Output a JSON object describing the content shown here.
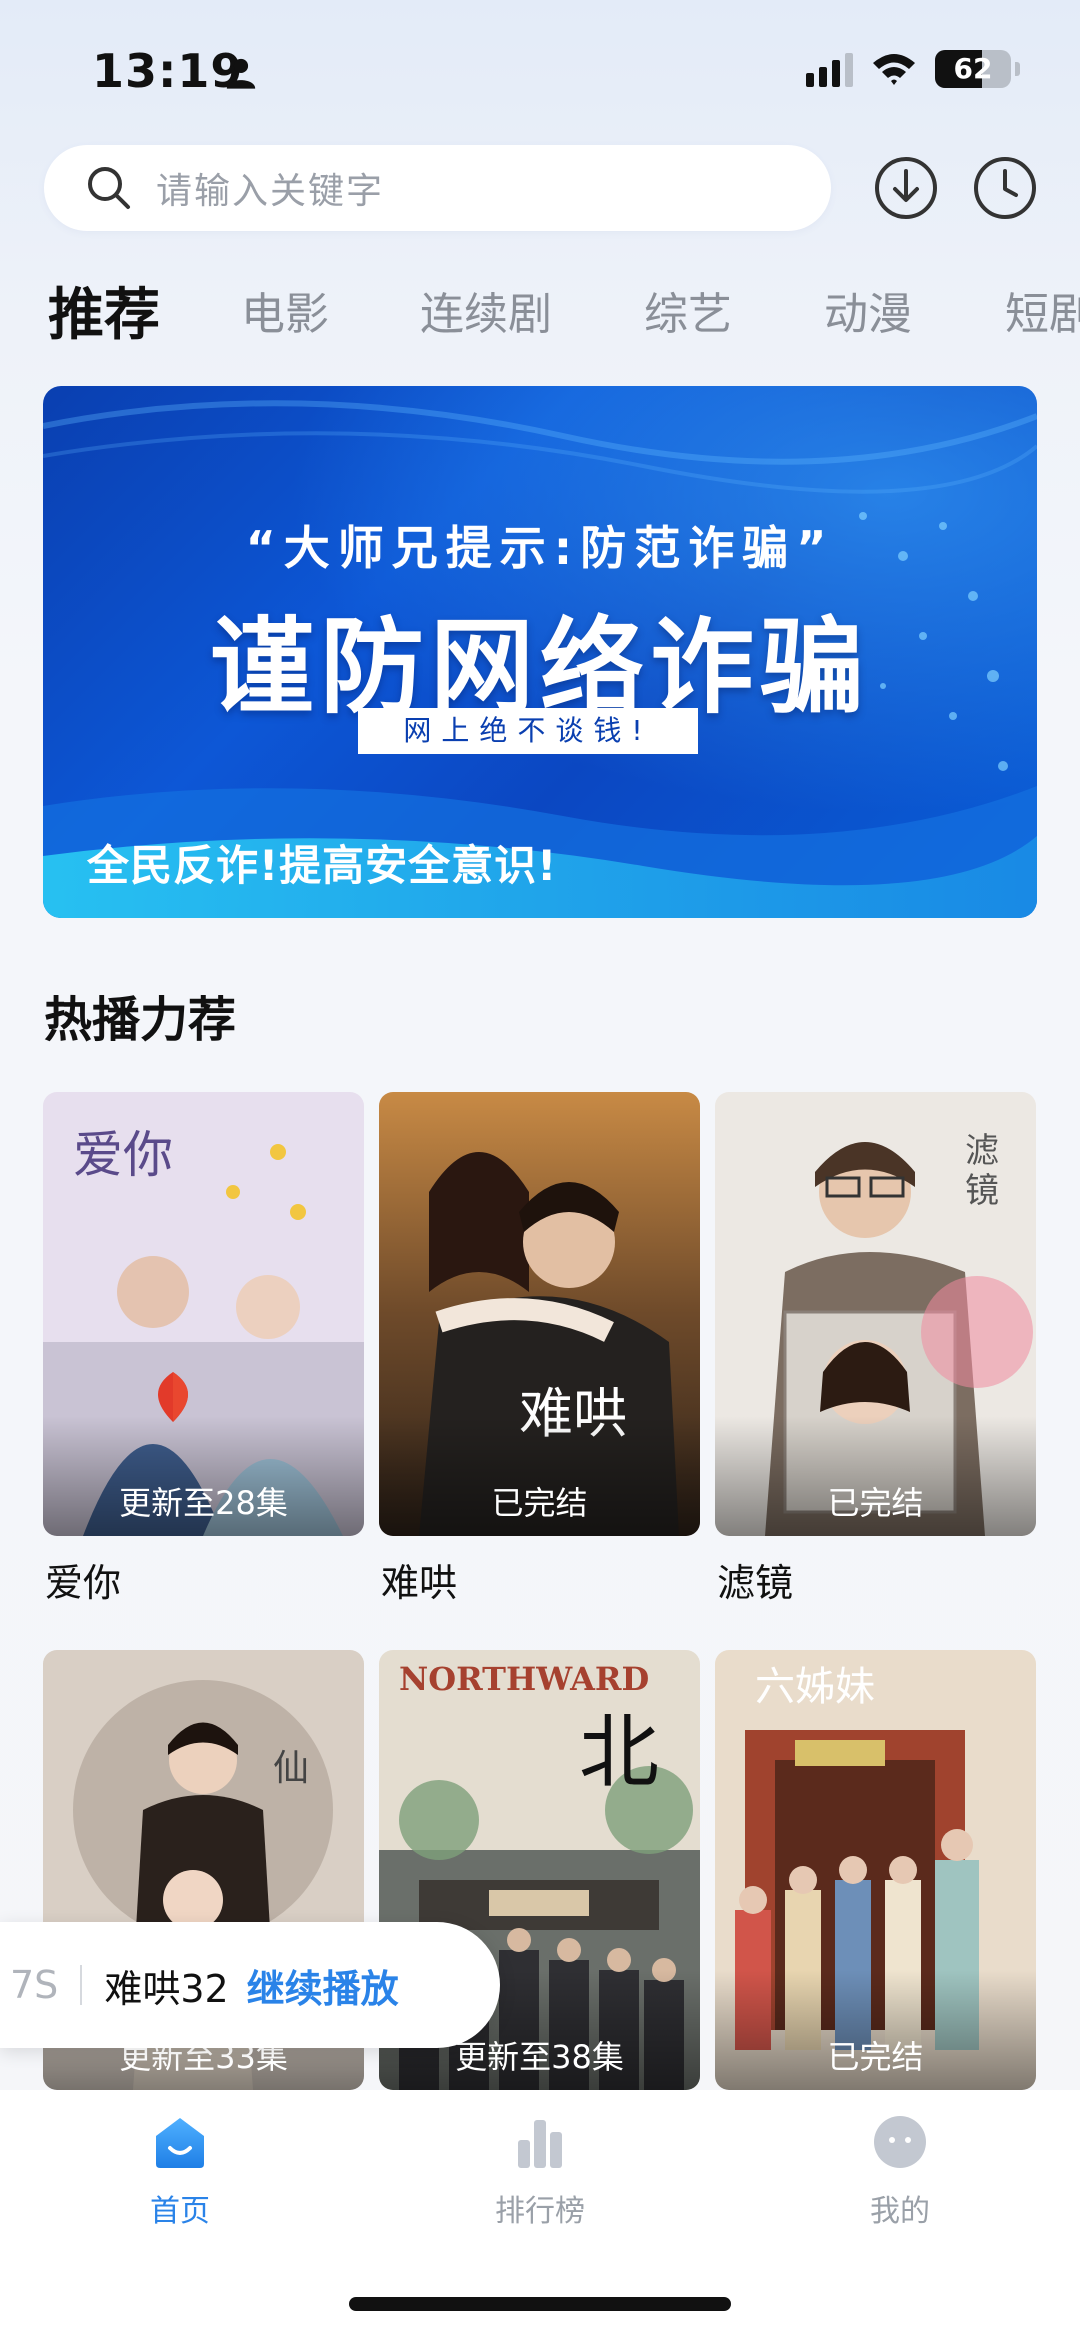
{
  "status_bar": {
    "time": "13:19",
    "battery": "62"
  },
  "search": {
    "placeholder": "请输入关键字"
  },
  "header_icons": [
    "download-icon",
    "history-icon"
  ],
  "tabs": [
    {
      "label": "推荐",
      "active": true
    },
    {
      "label": "电影"
    },
    {
      "label": "连续剧"
    },
    {
      "label": "综艺"
    },
    {
      "label": "动漫"
    },
    {
      "label": "短剧"
    }
  ],
  "banner": {
    "subtitle": "“大师兄提示:防范诈骗”",
    "title": "谨防网络诈骗",
    "tag": "网上绝不谈钱!",
    "bottom_text": "全民反诈!提高安全意识!"
  },
  "section": {
    "title": "热播力荐"
  },
  "shows": [
    {
      "title": "爱你",
      "status": "更新至28集"
    },
    {
      "title": "难哄",
      "status": "已完结"
    },
    {
      "title": "滤镜",
      "status": "已完结"
    },
    {
      "title": "",
      "status": "更新至33集"
    },
    {
      "title": "",
      "status": "更新至38集"
    },
    {
      "title": "",
      "status": "已完结"
    }
  ],
  "continue_playing": {
    "time": "7S",
    "title": "难哄32",
    "action": "继续播放"
  },
  "bottom_nav": [
    {
      "label": "首页",
      "active": true
    },
    {
      "label": "排行榜"
    },
    {
      "label": "我的"
    }
  ],
  "colors": {
    "accent": "#2a83e8",
    "banner_blue": "#0d57d6"
  }
}
